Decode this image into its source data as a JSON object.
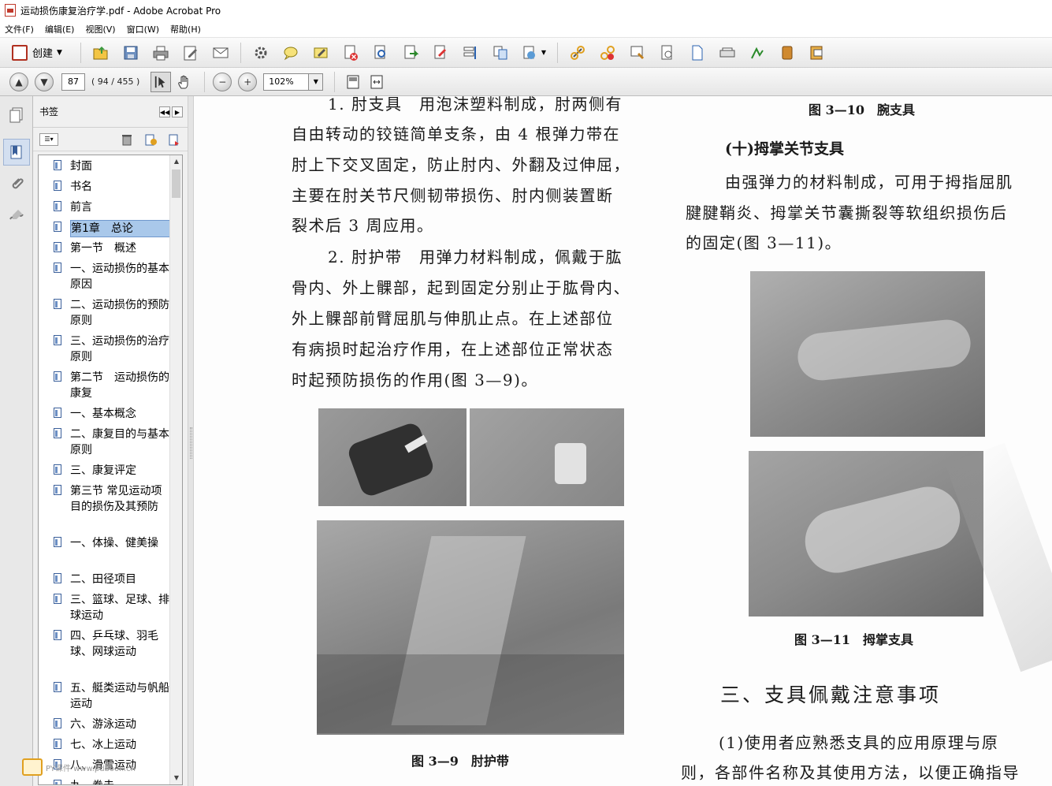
{
  "window": {
    "title": "运动损伤康复治疗学.pdf - Adobe Acrobat Pro"
  },
  "menu": [
    "文件(F)",
    "编辑(E)",
    "视图(V)",
    "窗口(W)",
    "帮助(H)"
  ],
  "toolbar": {
    "create_label": "创建"
  },
  "nav": {
    "page_number": "87",
    "page_count": "( 94 / 455 )",
    "zoom": "102%"
  },
  "bookmarks": {
    "title": "书签",
    "items": [
      "封面",
      "书名",
      "前言",
      "第1章　总论",
      "第一节　概述",
      "一、运动损伤的基本原因",
      "二、运动损伤的预防原则",
      "三、运动损伤的治疗原则",
      "第二节　运动损伤的康复",
      "一、基本概念",
      "二、康复目的与基本原则",
      "三、康复评定",
      "第三节 常见运动项目的损伤及其预防",
      "一、体操、健美操",
      "二、田径项目",
      "三、篮球、足球、排球运动",
      "四、乒乓球、羽毛球、网球运动",
      "五、艇类运动与帆船运动",
      "六、游泳运动",
      "七、冰上运动",
      "八、滑雪运动",
      "九、拳击"
    ],
    "selected_index": 3
  },
  "document": {
    "left_column": [
      "1. 肘支具　用泡沫塑料制成，肘两侧有",
      "自由转动的铰链简单支条，由 4 根弹力带在",
      "肘上下交叉固定，防止肘内、外翻及过伸屈，",
      "主要在肘关节尺侧韧带损伤、肘内侧装置断",
      "裂术后 3 周应用。",
      "2. 肘护带　用弹力材料制成，佩戴于肱",
      "骨内、外上髁部，起到固定分别止于肱骨内、",
      "外上髁部前臂屈肌与伸肌止点。在上述部位",
      "有病损时起治疗作用，在上述部位正常状态",
      "时起预防损伤的作用(图 3—9)。"
    ],
    "caption_fig9": "图 3—9　肘护带",
    "caption_fig10": "图 3—10　腕支具",
    "heading_10": "(十)拇掌关节支具",
    "right_column": [
      "由强弹力的材料制成，可用于拇指屈肌",
      "腱腱鞘炎、拇掌关节囊撕裂等软组织损伤后",
      "的固定(图 3—11)。"
    ],
    "caption_fig11": "图 3—11　拇掌支具",
    "section_heading": "三、支具佩戴注意事项",
    "bottom_lines": [
      "(1)使用者应熟悉支具的应用原理与原",
      "则，各部件名称及其使用方法，以便正确指导"
    ]
  },
  "logo_text": "PY课件 www.pdbook.cn"
}
